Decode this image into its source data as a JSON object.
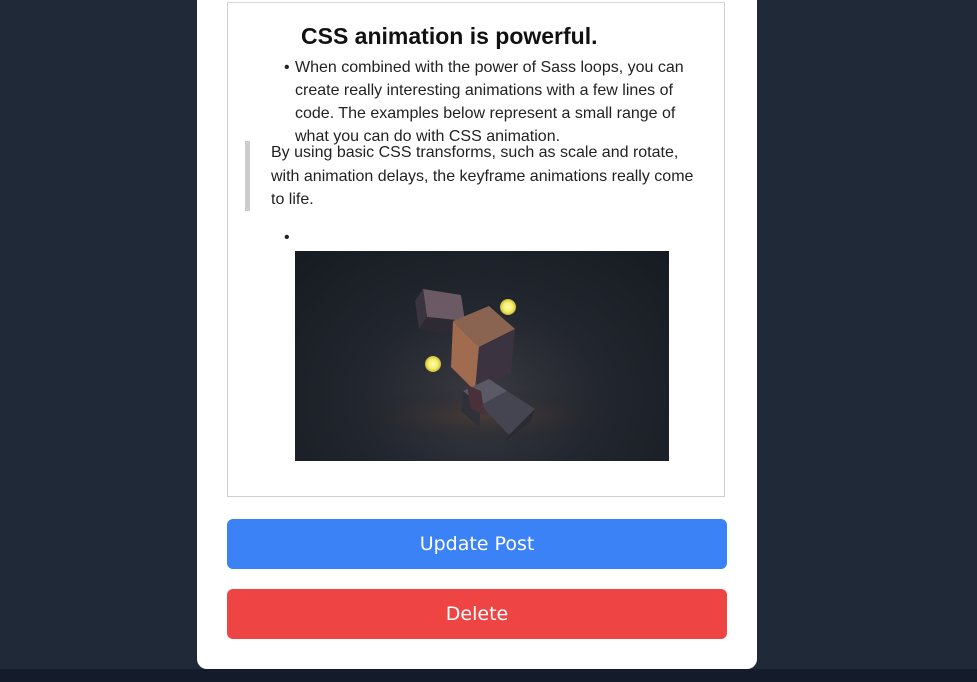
{
  "editor": {
    "heading": "CSS animation is powerful.",
    "bullet_1": "When combined with the power of Sass loops, you can create really interesting animations with a few lines of code. The examples below represent a small range of what you can do with CSS animation.",
    "blockquote": "By using basic CSS transforms, such as scale and rotate, with animation delays, the keyframe animations really come to life.",
    "bullet_glyph": "•",
    "image_subject": "dark-3d-cubes-with-glowing-spheres"
  },
  "actions": {
    "update_label": "Update Post",
    "delete_label": "Delete"
  },
  "colors": {
    "page_background": "#1f2937",
    "update_button": "#3b82f6",
    "delete_button": "#ef4444",
    "card": "#ffffff",
    "glow_sphere": "#f5f07a"
  }
}
